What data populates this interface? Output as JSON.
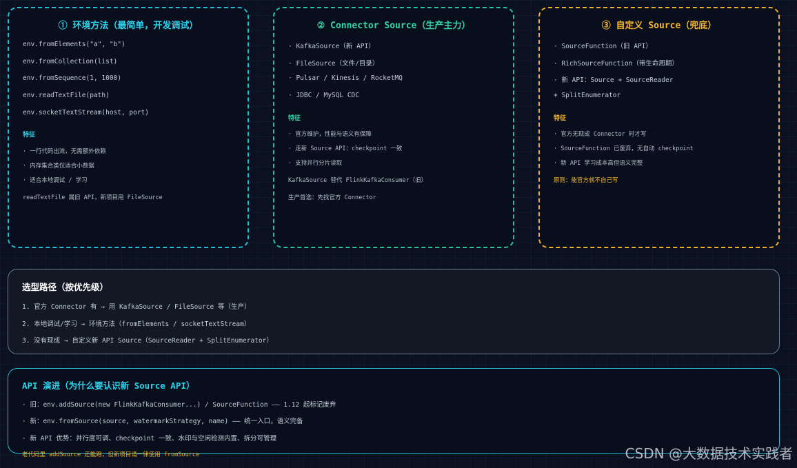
{
  "card1": {
    "title": "① 环境方法（最简单，开发调试）",
    "items": [
      "env.fromElements(\"a\", \"b\")",
      "env.fromCollection(list)",
      "env.fromSequence(1, 1000)",
      "env.readTextFile(path)",
      "env.socketTextStream(host, port)"
    ],
    "feature_label": "特征",
    "features": [
      "· 一行代码出流，无需额外依赖",
      "· 内存集合类仅适合小数据",
      "· 适合本地调试 / 学习"
    ],
    "note": "readTextFile 属旧 API，新项目用 FileSource"
  },
  "card2": {
    "title": "② Connector Source（生产主力）",
    "items": [
      "· KafkaSource（新 API）",
      "· FileSource（文件/目录）",
      "· Pulsar / Kinesis / RocketMQ",
      "· JDBC / MySQL CDC"
    ],
    "feature_label": "特征",
    "features": [
      "· 官方维护，性能与语义有保障",
      "· 走新 Source API：checkpoint 一致",
      "· 支持并行分片读取"
    ],
    "note1": "KafkaSource 替代 FlinkKafkaConsumer（旧）",
    "note2": "生产首选：先找官方 Connector"
  },
  "card3": {
    "title": "③ 自定义 Source（兜底）",
    "items": [
      "· SourceFunction（旧 API）",
      "· RichSourceFunction（带生命周期）",
      "· 新 API：Source + SourceReader",
      "+ SplitEnumerator"
    ],
    "feature_label": "特征",
    "features": [
      "· 官方无现成 Connector 时才写",
      "· SourceFunction 已废弃，无自动 checkpoint",
      "· 新 API 学习成本高但语义完整"
    ],
    "note": "原则：能官方就不自己写"
  },
  "path": {
    "title": "选型路径（按优先级）",
    "steps": [
      "1. 官方 Connector 有 → 用 KafkaSource / FileSource 等（生产）",
      "2. 本地调试/学习 → 环境方法（fromElements / socketTextStream）",
      "3. 没有现成 → 自定义新 API Source（SourceReader + SplitEnumerator）"
    ]
  },
  "api": {
    "title": "API 演进（为什么要认识新 Source API）",
    "items": [
      "· 旧：env.addSource(new FlinkKafkaConsumer...) / SourceFunction —— 1.12 起标记废弃",
      "· 新：env.fromSource(source, watermarkStrategy, name) —— 统一入口，语义完备",
      "· 新 API 优势：并行度可调、checkpoint 一致、水印与空闲检测内置、拆分可管理"
    ]
  },
  "footnote": "老代码里 addSource 还能跑，但新项目请一律使用 fromSource",
  "watermark": "CSDN @大数据技术实践者"
}
